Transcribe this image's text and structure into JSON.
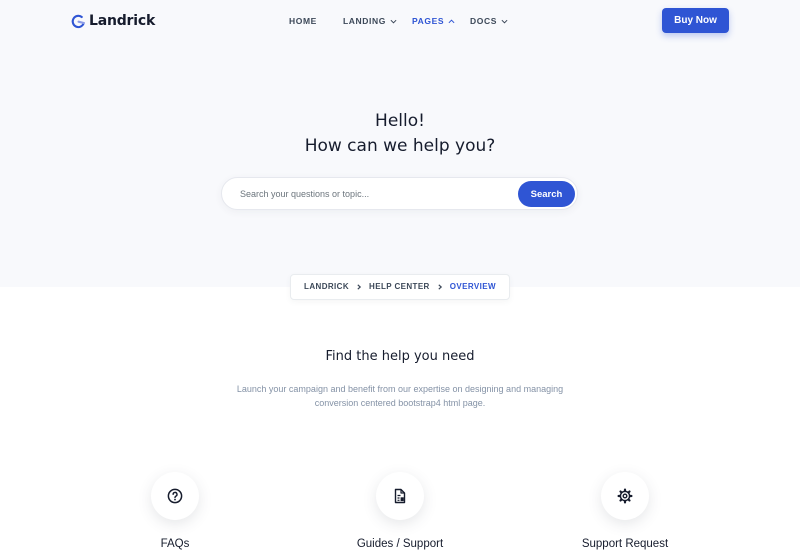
{
  "nav": {
    "brand": "Landrick",
    "items": [
      {
        "label": "HOME"
      },
      {
        "label": "LANDING"
      },
      {
        "label": "PAGES"
      },
      {
        "label": "DOCS"
      }
    ],
    "cta": "Buy Now",
    "active_color": "#2f55d4"
  },
  "hero": {
    "line1": "Hello!",
    "line2": "How can we help you?",
    "search_placeholder": "Search your questions or topic...",
    "search_button": "Search"
  },
  "breadcrumb": {
    "items": [
      "LANDRICK",
      "HELP CENTER",
      "OVERVIEW"
    ]
  },
  "section": {
    "title": "Find the help you need",
    "description_line1": "Launch your campaign and benefit from our expertise on designing and managing",
    "description_line2": "conversion centered bootstrap4 html page."
  },
  "features": [
    {
      "label": "FAQs",
      "icon": "question-circle-icon"
    },
    {
      "label": "Guides / Support",
      "icon": "document-icon"
    },
    {
      "label": "Support Request",
      "icon": "gear-icon"
    }
  ],
  "colors": {
    "primary": "#2f55d4",
    "hero_background": "#f8f9fc",
    "heading": "#161c2d",
    "muted": "#8492a6"
  }
}
